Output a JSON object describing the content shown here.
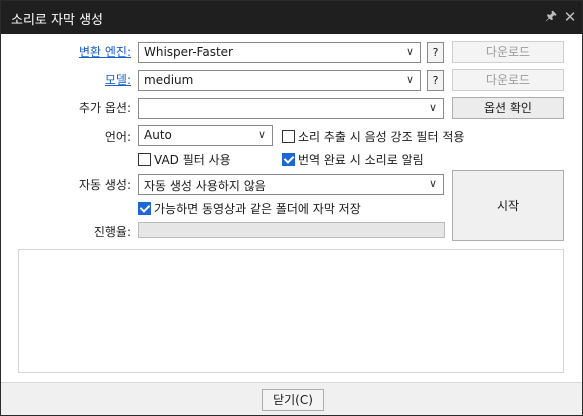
{
  "window": {
    "title": "소리로 자막 생성",
    "pin_icon": "pin-icon",
    "close_icon": "close-icon"
  },
  "engine": {
    "label": "변환 엔진:",
    "value": "Whisper-Faster",
    "help": "?",
    "download": "다운로드"
  },
  "model": {
    "label": "모델:",
    "value": "medium",
    "help": "?",
    "download": "다운로드"
  },
  "extra": {
    "label": "추가 옵션:",
    "value": "",
    "confirm": "옵션 확인"
  },
  "language": {
    "label": "언어:",
    "value": "Auto"
  },
  "options": {
    "vocal_filter": {
      "label": "소리 추출 시 음성 강조 필터 적용",
      "checked": false
    },
    "vad_filter": {
      "label": "VAD 필터 사용",
      "checked": false
    },
    "notify": {
      "label": "번역 완료 시 소리로 알림",
      "checked": true
    },
    "save_same_folder": {
      "label": "가능하면 동영상과 같은 폴더에 자막 저장",
      "checked": true
    }
  },
  "auto": {
    "label": "자동 생성:",
    "value": "자동 생성 사용하지 않음"
  },
  "start": "시작",
  "progress": {
    "label": "진행율:",
    "value": 0
  },
  "log": "",
  "close_button": "닫기(C)",
  "colors": {
    "titlebar": "#1f1f1f",
    "link": "#1a5fcc",
    "check": "#1c66d6"
  }
}
